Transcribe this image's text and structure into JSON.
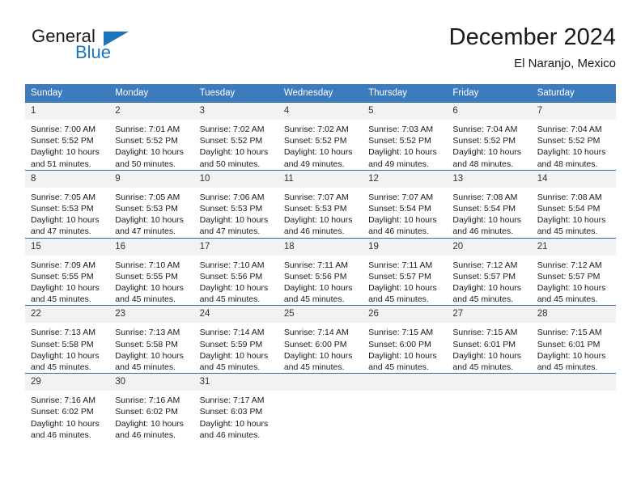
{
  "brand": {
    "name_part1": "General",
    "name_part2": "Blue",
    "logo_icon": "triangle-logo-icon"
  },
  "header": {
    "month_title": "December 2024",
    "location": "El Naranjo, Mexico"
  },
  "colors": {
    "header_blue": "#3c7cbd",
    "border_blue": "#2e6da4",
    "daynum_bg": "#f2f2f2",
    "brand_blue": "#1b75bb",
    "text": "#1a1a1a"
  },
  "calendar": {
    "weekday_headers": [
      "Sunday",
      "Monday",
      "Tuesday",
      "Wednesday",
      "Thursday",
      "Friday",
      "Saturday"
    ],
    "weeks": [
      [
        {
          "day": "1",
          "sunrise": "Sunrise: 7:00 AM",
          "sunset": "Sunset: 5:52 PM",
          "daylight": "Daylight: 10 hours and 51 minutes."
        },
        {
          "day": "2",
          "sunrise": "Sunrise: 7:01 AM",
          "sunset": "Sunset: 5:52 PM",
          "daylight": "Daylight: 10 hours and 50 minutes."
        },
        {
          "day": "3",
          "sunrise": "Sunrise: 7:02 AM",
          "sunset": "Sunset: 5:52 PM",
          "daylight": "Daylight: 10 hours and 50 minutes."
        },
        {
          "day": "4",
          "sunrise": "Sunrise: 7:02 AM",
          "sunset": "Sunset: 5:52 PM",
          "daylight": "Daylight: 10 hours and 49 minutes."
        },
        {
          "day": "5",
          "sunrise": "Sunrise: 7:03 AM",
          "sunset": "Sunset: 5:52 PM",
          "daylight": "Daylight: 10 hours and 49 minutes."
        },
        {
          "day": "6",
          "sunrise": "Sunrise: 7:04 AM",
          "sunset": "Sunset: 5:52 PM",
          "daylight": "Daylight: 10 hours and 48 minutes."
        },
        {
          "day": "7",
          "sunrise": "Sunrise: 7:04 AM",
          "sunset": "Sunset: 5:52 PM",
          "daylight": "Daylight: 10 hours and 48 minutes."
        }
      ],
      [
        {
          "day": "8",
          "sunrise": "Sunrise: 7:05 AM",
          "sunset": "Sunset: 5:53 PM",
          "daylight": "Daylight: 10 hours and 47 minutes."
        },
        {
          "day": "9",
          "sunrise": "Sunrise: 7:05 AM",
          "sunset": "Sunset: 5:53 PM",
          "daylight": "Daylight: 10 hours and 47 minutes."
        },
        {
          "day": "10",
          "sunrise": "Sunrise: 7:06 AM",
          "sunset": "Sunset: 5:53 PM",
          "daylight": "Daylight: 10 hours and 47 minutes."
        },
        {
          "day": "11",
          "sunrise": "Sunrise: 7:07 AM",
          "sunset": "Sunset: 5:53 PM",
          "daylight": "Daylight: 10 hours and 46 minutes."
        },
        {
          "day": "12",
          "sunrise": "Sunrise: 7:07 AM",
          "sunset": "Sunset: 5:54 PM",
          "daylight": "Daylight: 10 hours and 46 minutes."
        },
        {
          "day": "13",
          "sunrise": "Sunrise: 7:08 AM",
          "sunset": "Sunset: 5:54 PM",
          "daylight": "Daylight: 10 hours and 46 minutes."
        },
        {
          "day": "14",
          "sunrise": "Sunrise: 7:08 AM",
          "sunset": "Sunset: 5:54 PM",
          "daylight": "Daylight: 10 hours and 45 minutes."
        }
      ],
      [
        {
          "day": "15",
          "sunrise": "Sunrise: 7:09 AM",
          "sunset": "Sunset: 5:55 PM",
          "daylight": "Daylight: 10 hours and 45 minutes."
        },
        {
          "day": "16",
          "sunrise": "Sunrise: 7:10 AM",
          "sunset": "Sunset: 5:55 PM",
          "daylight": "Daylight: 10 hours and 45 minutes."
        },
        {
          "day": "17",
          "sunrise": "Sunrise: 7:10 AM",
          "sunset": "Sunset: 5:56 PM",
          "daylight": "Daylight: 10 hours and 45 minutes."
        },
        {
          "day": "18",
          "sunrise": "Sunrise: 7:11 AM",
          "sunset": "Sunset: 5:56 PM",
          "daylight": "Daylight: 10 hours and 45 minutes."
        },
        {
          "day": "19",
          "sunrise": "Sunrise: 7:11 AM",
          "sunset": "Sunset: 5:57 PM",
          "daylight": "Daylight: 10 hours and 45 minutes."
        },
        {
          "day": "20",
          "sunrise": "Sunrise: 7:12 AM",
          "sunset": "Sunset: 5:57 PM",
          "daylight": "Daylight: 10 hours and 45 minutes."
        },
        {
          "day": "21",
          "sunrise": "Sunrise: 7:12 AM",
          "sunset": "Sunset: 5:57 PM",
          "daylight": "Daylight: 10 hours and 45 minutes."
        }
      ],
      [
        {
          "day": "22",
          "sunrise": "Sunrise: 7:13 AM",
          "sunset": "Sunset: 5:58 PM",
          "daylight": "Daylight: 10 hours and 45 minutes."
        },
        {
          "day": "23",
          "sunrise": "Sunrise: 7:13 AM",
          "sunset": "Sunset: 5:58 PM",
          "daylight": "Daylight: 10 hours and 45 minutes."
        },
        {
          "day": "24",
          "sunrise": "Sunrise: 7:14 AM",
          "sunset": "Sunset: 5:59 PM",
          "daylight": "Daylight: 10 hours and 45 minutes."
        },
        {
          "day": "25",
          "sunrise": "Sunrise: 7:14 AM",
          "sunset": "Sunset: 6:00 PM",
          "daylight": "Daylight: 10 hours and 45 minutes."
        },
        {
          "day": "26",
          "sunrise": "Sunrise: 7:15 AM",
          "sunset": "Sunset: 6:00 PM",
          "daylight": "Daylight: 10 hours and 45 minutes."
        },
        {
          "day": "27",
          "sunrise": "Sunrise: 7:15 AM",
          "sunset": "Sunset: 6:01 PM",
          "daylight": "Daylight: 10 hours and 45 minutes."
        },
        {
          "day": "28",
          "sunrise": "Sunrise: 7:15 AM",
          "sunset": "Sunset: 6:01 PM",
          "daylight": "Daylight: 10 hours and 45 minutes."
        }
      ],
      [
        {
          "day": "29",
          "sunrise": "Sunrise: 7:16 AM",
          "sunset": "Sunset: 6:02 PM",
          "daylight": "Daylight: 10 hours and 46 minutes."
        },
        {
          "day": "30",
          "sunrise": "Sunrise: 7:16 AM",
          "sunset": "Sunset: 6:02 PM",
          "daylight": "Daylight: 10 hours and 46 minutes."
        },
        {
          "day": "31",
          "sunrise": "Sunrise: 7:17 AM",
          "sunset": "Sunset: 6:03 PM",
          "daylight": "Daylight: 10 hours and 46 minutes."
        },
        {
          "day": "",
          "sunrise": "",
          "sunset": "",
          "daylight": ""
        },
        {
          "day": "",
          "sunrise": "",
          "sunset": "",
          "daylight": ""
        },
        {
          "day": "",
          "sunrise": "",
          "sunset": "",
          "daylight": ""
        },
        {
          "day": "",
          "sunrise": "",
          "sunset": "",
          "daylight": ""
        }
      ]
    ]
  }
}
